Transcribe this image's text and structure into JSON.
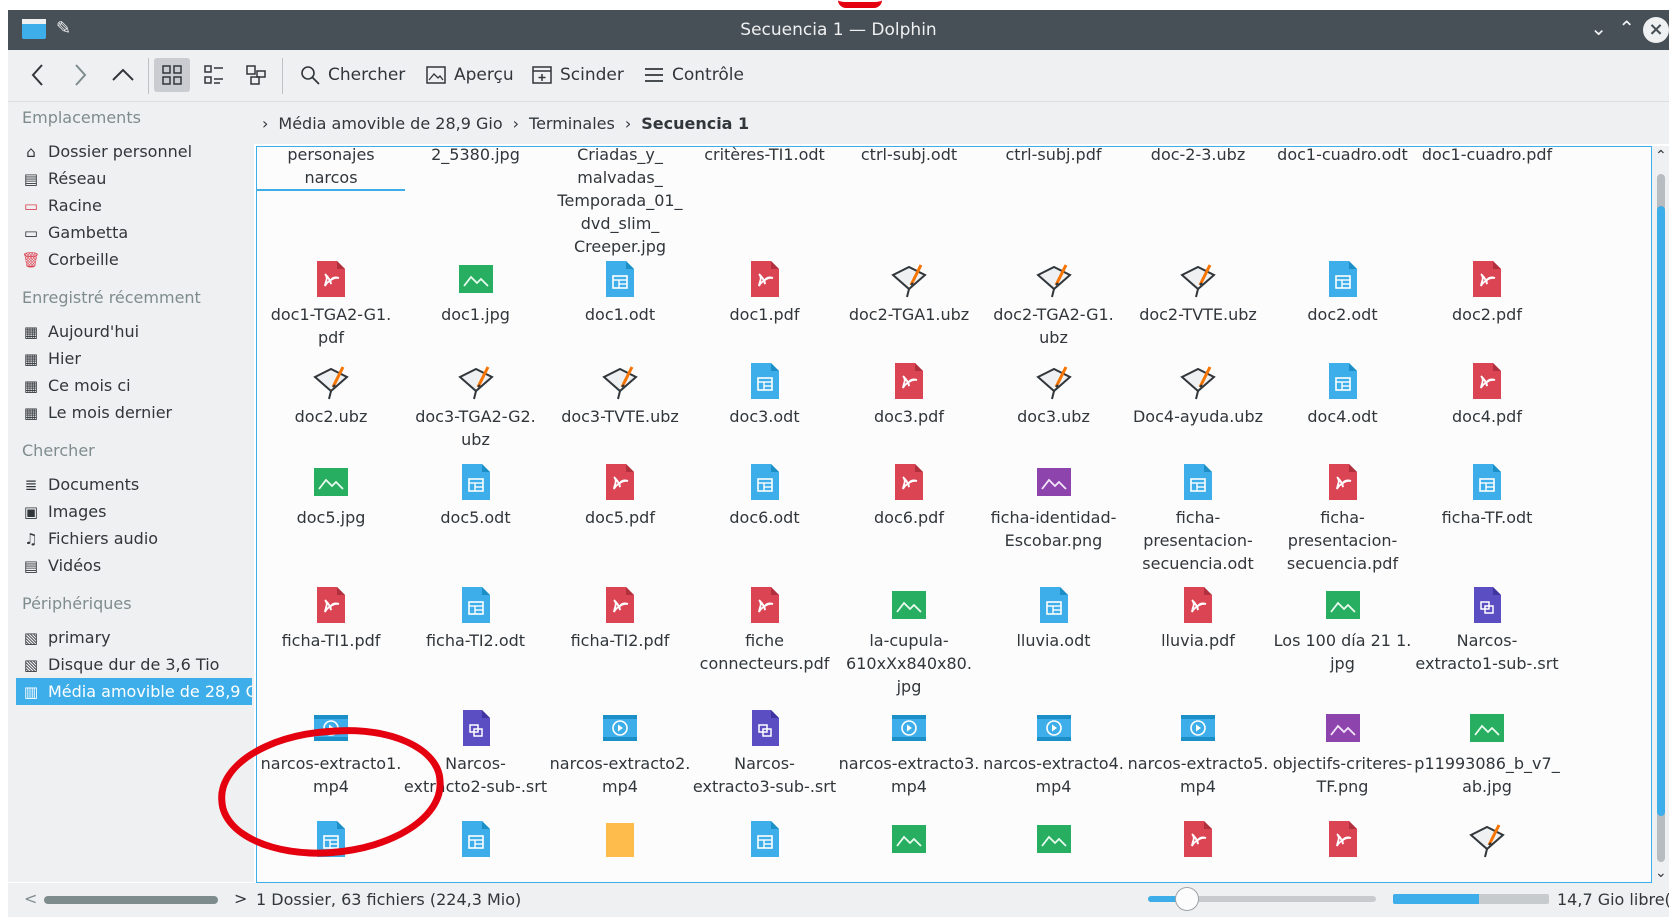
{
  "window": {
    "title": "Secuencia 1 — Dolphin"
  },
  "toolbar": {
    "search_label": "Chercher",
    "preview_label": "Aperçu",
    "split_label": "Scinder",
    "control_label": "Contrôle"
  },
  "sidebar": {
    "sections": [
      {
        "label": "Emplacements",
        "items": [
          {
            "label": "Dossier personnel",
            "icon": "home-icon"
          },
          {
            "label": "Réseau",
            "icon": "network-icon"
          },
          {
            "label": "Racine",
            "icon": "root-folder-icon"
          },
          {
            "label": "Gambetta",
            "icon": "folder-icon"
          },
          {
            "label": "Corbeille",
            "icon": "trash-icon"
          }
        ]
      },
      {
        "label": "Enregistré récemment",
        "items": [
          {
            "label": "Aujourd'hui",
            "icon": "calendar-icon"
          },
          {
            "label": "Hier",
            "icon": "calendar-icon"
          },
          {
            "label": "Ce mois ci",
            "icon": "calendar-icon"
          },
          {
            "label": "Le mois dernier",
            "icon": "calendar-icon"
          }
        ]
      },
      {
        "label": "Chercher",
        "items": [
          {
            "label": "Documents",
            "icon": "documents-icon"
          },
          {
            "label": "Images",
            "icon": "image-icon"
          },
          {
            "label": "Fichiers audio",
            "icon": "music-icon"
          },
          {
            "label": "Vidéos",
            "icon": "video-icon"
          }
        ]
      },
      {
        "label": "Périphériques",
        "items": [
          {
            "label": "primary",
            "icon": "drive-icon"
          },
          {
            "label": "Disque dur de 3,6 Tio",
            "icon": "drive-icon"
          },
          {
            "label": "Média amovible de 28,9 Gio",
            "icon": "usb-drive-icon",
            "selected": true
          }
        ]
      }
    ]
  },
  "breadcrumb": {
    "items": [
      "Média amovible de 28,9 Gio",
      "Terminales"
    ],
    "current": "Secuencia 1"
  },
  "files": [
    {
      "name": "personajes narcos",
      "type": "folder",
      "no_icon": true,
      "current": true
    },
    {
      "name": "2_5380.jpg",
      "type": "image",
      "no_icon": true
    },
    {
      "name": "Criadas_y_ malvadas_ Temporada_01_ dvd_slim_ Creeper.jpg",
      "type": "image",
      "no_icon": true
    },
    {
      "name": "critères-TI1.odt",
      "type": "odt",
      "no_icon": true
    },
    {
      "name": "ctrl-subj.odt",
      "type": "odt",
      "no_icon": true
    },
    {
      "name": "ctrl-subj.pdf",
      "type": "pdf",
      "no_icon": true
    },
    {
      "name": "doc-2-3.ubz",
      "type": "ubz",
      "no_icon": true
    },
    {
      "name": "doc1-cuadro.odt",
      "type": "odt",
      "no_icon": true
    },
    {
      "name": "doc1-cuadro.pdf",
      "type": "pdf",
      "no_icon": true
    },
    {
      "name": "doc1-TGA2-G1. pdf",
      "type": "pdf"
    },
    {
      "name": "doc1.jpg",
      "type": "image"
    },
    {
      "name": "doc1.odt",
      "type": "odt"
    },
    {
      "name": "doc1.pdf",
      "type": "pdf"
    },
    {
      "name": "doc2-TGA1.ubz",
      "type": "ubz"
    },
    {
      "name": "doc2-TGA2-G1. ubz",
      "type": "ubz"
    },
    {
      "name": "doc2-TVTE.ubz",
      "type": "ubz"
    },
    {
      "name": "doc2.odt",
      "type": "odt"
    },
    {
      "name": "doc2.pdf",
      "type": "pdf"
    },
    {
      "name": "doc2.ubz",
      "type": "ubz"
    },
    {
      "name": "doc3-TGA2-G2. ubz",
      "type": "ubz"
    },
    {
      "name": "doc3-TVTE.ubz",
      "type": "ubz"
    },
    {
      "name": "doc3.odt",
      "type": "odt"
    },
    {
      "name": "doc3.pdf",
      "type": "pdf"
    },
    {
      "name": "doc3.ubz",
      "type": "ubz"
    },
    {
      "name": "Doc4-ayuda.ubz",
      "type": "ubz"
    },
    {
      "name": "doc4.odt",
      "type": "odt"
    },
    {
      "name": "doc4.pdf",
      "type": "pdf"
    },
    {
      "name": "doc5.jpg",
      "type": "image"
    },
    {
      "name": "doc5.odt",
      "type": "odt"
    },
    {
      "name": "doc5.pdf",
      "type": "pdf"
    },
    {
      "name": "doc6.odt",
      "type": "odt"
    },
    {
      "name": "doc6.pdf",
      "type": "pdf"
    },
    {
      "name": "ficha-identidad- Escobar.png",
      "type": "png"
    },
    {
      "name": "ficha- presentacion- secuencia.odt",
      "type": "odt"
    },
    {
      "name": "ficha- presentacion- secuencia.pdf",
      "type": "pdf"
    },
    {
      "name": "ficha-TF.odt",
      "type": "odt"
    },
    {
      "name": "ficha-TI1.pdf",
      "type": "pdf"
    },
    {
      "name": "ficha-TI2.odt",
      "type": "odt"
    },
    {
      "name": "ficha-TI2.pdf",
      "type": "pdf"
    },
    {
      "name": "fiche connecteurs.pdf",
      "type": "pdf"
    },
    {
      "name": "la-cupula- 610xXx840x80. jpg",
      "type": "image"
    },
    {
      "name": "lluvia.odt",
      "type": "odt"
    },
    {
      "name": "lluvia.pdf",
      "type": "pdf"
    },
    {
      "name": "Los 100 día 21 1. jpg",
      "type": "image"
    },
    {
      "name": "Narcos- extracto1-sub-.srt",
      "type": "srt"
    },
    {
      "name": "narcos-extracto1. mp4",
      "type": "video"
    },
    {
      "name": "Narcos- extracto2-sub-.srt",
      "type": "srt"
    },
    {
      "name": "narcos-extracto2. mp4",
      "type": "video"
    },
    {
      "name": "Narcos- extracto3-sub-.srt",
      "type": "srt"
    },
    {
      "name": "narcos-extracto3. mp4",
      "type": "video"
    },
    {
      "name": "narcos-extracto4. mp4",
      "type": "video"
    },
    {
      "name": "narcos-extracto5. mp4",
      "type": "video"
    },
    {
      "name": "objectifs-criteres- TF.png",
      "type": "png"
    },
    {
      "name": "p11993086_b_v7_ ab.jpg",
      "type": "image"
    },
    {
      "name": "",
      "type": "odt"
    },
    {
      "name": "",
      "type": "odt"
    },
    {
      "name": "",
      "type": "note"
    },
    {
      "name": "",
      "type": "odt"
    },
    {
      "name": "",
      "type": "image"
    },
    {
      "name": "",
      "type": "image"
    },
    {
      "name": "",
      "type": "pdf"
    },
    {
      "name": "",
      "type": "pdf"
    },
    {
      "name": "",
      "type": "ubz"
    }
  ],
  "statusbar": {
    "text": "1 Dossier, 63 fichiers (224,3 Mio)",
    "zoom_level": 0.17,
    "space_used_fraction": 0.55,
    "free_space": "14,7 Gio libre(s)"
  },
  "colors": {
    "accent": "#3daee9",
    "pdf": "#da4453",
    "odt": "#3daee9",
    "image": "#27ae60",
    "png": "#8e44ad",
    "srt": "#5b4ec2",
    "annotation": "#e4000f"
  }
}
